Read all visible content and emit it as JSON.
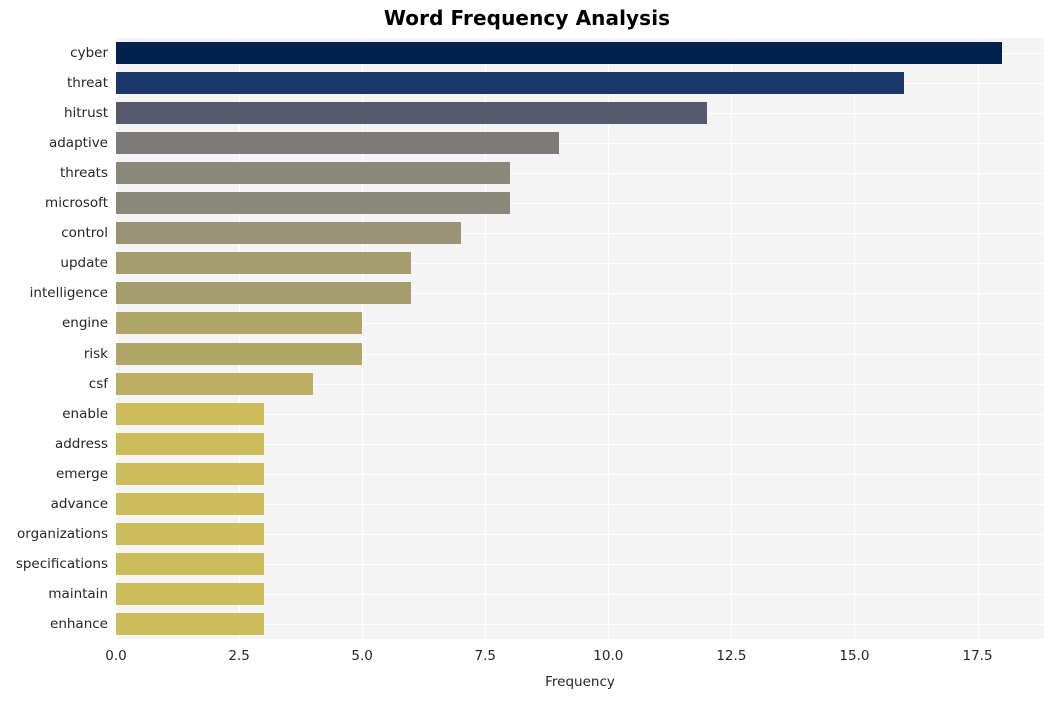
{
  "chart_data": {
    "type": "bar",
    "orientation": "horizontal",
    "title": "Word Frequency Analysis",
    "xlabel": "Frequency",
    "ylabel": "",
    "categories": [
      "cyber",
      "threat",
      "hitrust",
      "adaptive",
      "threats",
      "microsoft",
      "control",
      "update",
      "intelligence",
      "engine",
      "risk",
      "csf",
      "enable",
      "address",
      "emerge",
      "advance",
      "organizations",
      "specifications",
      "maintain",
      "enhance"
    ],
    "values": [
      18,
      16,
      12,
      9,
      8,
      8,
      7,
      6,
      6,
      5,
      5,
      4,
      3,
      3,
      3,
      3,
      3,
      3,
      3,
      3
    ],
    "bar_colors": [
      "#00224e",
      "#1b3668",
      "#575a6e",
      "#7c7b78",
      "#8a8878",
      "#8a8878",
      "#9a9377",
      "#a69d6e",
      "#a69d6e",
      "#b0a668",
      "#b0a668",
      "#bdaf61",
      "#cdbc5c",
      "#cdbc5c",
      "#cdbc5c",
      "#cdbc5c",
      "#cdbc5c",
      "#cdbc5c",
      "#cdbc5c",
      "#cdbc5c"
    ],
    "xlim": [
      0,
      18.85
    ],
    "xticks": [
      0.0,
      2.5,
      5.0,
      7.5,
      10.0,
      12.5,
      15.0,
      17.5
    ],
    "xtick_labels": [
      "0.0",
      "2.5",
      "5.0",
      "7.5",
      "10.0",
      "12.5",
      "15.0",
      "17.5"
    ],
    "grid": true,
    "legend": null,
    "plot_background": "#f4f4f4",
    "figure_background": "#ffffff",
    "gridline_color": "#ffffff",
    "text_color": "#262626"
  }
}
